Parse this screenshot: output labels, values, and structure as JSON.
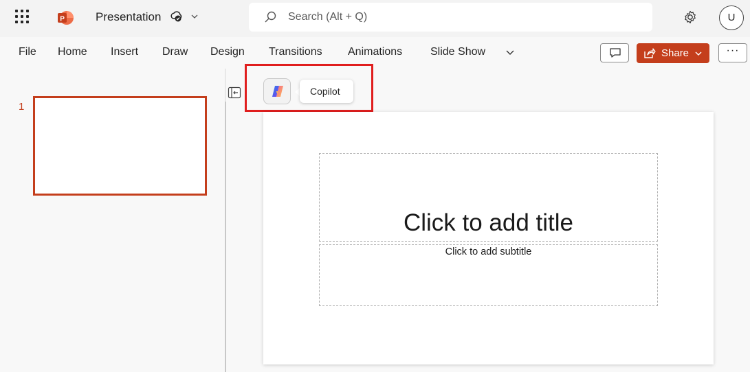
{
  "app": {
    "title": "Presentation",
    "brand_color": "#c43e1c"
  },
  "search": {
    "placeholder": "Search (Alt + Q)"
  },
  "account": {
    "avatar_initial": "U"
  },
  "ribbon": {
    "tabs": [
      "File",
      "Home",
      "Insert",
      "Draw",
      "Design",
      "Transitions",
      "Animations",
      "Slide Show"
    ],
    "share_label": "Share",
    "more_label": "···"
  },
  "slides": {
    "items": [
      {
        "number": "1"
      }
    ]
  },
  "copilot": {
    "label": "Copilot"
  },
  "slide_canvas": {
    "title_placeholder": "Click to add title",
    "subtitle_placeholder": "Click to add subtitle"
  },
  "icons": [
    "app-launcher-icon",
    "powerpoint-logo-icon",
    "saved-status-icon",
    "chevron-down-icon",
    "search-icon",
    "gear-icon",
    "comments-icon",
    "share-icon",
    "collapse-pane-icon",
    "copilot-icon"
  ]
}
